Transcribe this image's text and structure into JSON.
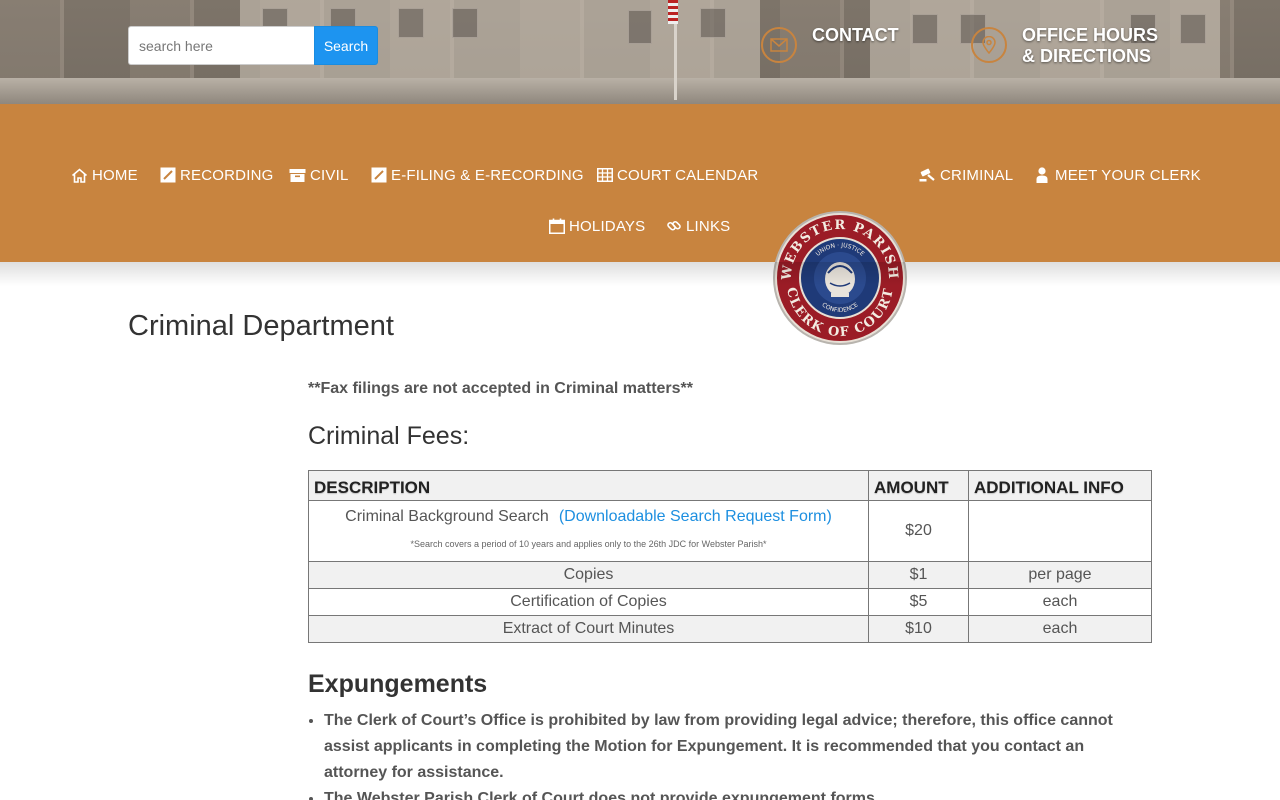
{
  "header": {
    "search_placeholder": "search here",
    "search_button": "Search",
    "contact_label": "CONTACT",
    "hours_label": "OFFICE HOURS\n& DIRECTIONS"
  },
  "nav": {
    "home": "HOME",
    "recording": "RECORDING",
    "civil": "CIVIL",
    "efiling": "E-FILING & E-RECORDING",
    "calendar": "COURT CALENDAR",
    "criminal": "CRIMINAL",
    "clerk": "MEET YOUR CLERK",
    "holidays": "HOLIDAYS",
    "links": "LINKS"
  },
  "seal": {
    "top_text": "WEBSTER PARISH",
    "bottom_text": "CLERK OF COURT",
    "inner_top": "UNION · JUSTICE",
    "inner_bottom": "CONFIDENCE"
  },
  "page": {
    "title": "Criminal Department",
    "fax_notice": "**Fax filings are not accepted in Criminal matters**",
    "fees_heading": "Criminal Fees:"
  },
  "fees_table": {
    "headers": [
      "DESCRIPTION",
      "AMOUNT",
      "ADDITIONAL INFO"
    ],
    "background_search": {
      "description": "Criminal Background Search",
      "link": "(Downloadable Search Request Form)",
      "note": "*Search covers a period of 10 years and applies only to the 26th JDC for Webster Parish*",
      "amount": "$20",
      "info": ""
    },
    "rows": [
      {
        "description": "Copies",
        "amount": "$1",
        "info": "per page"
      },
      {
        "description": "Certification of Copies",
        "amount": "$5",
        "info": "each"
      },
      {
        "description": "Extract of Court Minutes",
        "amount": "$10",
        "info": "each"
      }
    ]
  },
  "expungements": {
    "heading": "Expungements",
    "items": [
      "The Clerk of Court’s Office is prohibited by law from providing legal advice; therefore, this office cannot assist applicants in completing the Motion for Expungement. It is recommended that you contact an attorney for assistance.",
      "The Webster Parish Clerk of Court does not provide expungement forms."
    ]
  },
  "colors": {
    "nav_background": "#c8843f",
    "search_button": "#1d94f0",
    "link": "#1d8fe0",
    "seal_ring": "#9b1c26",
    "seal_center": "#1f3a78"
  },
  "icons": {
    "contact": "envelope-icon",
    "hours": "map-pin-icon",
    "home": "home-icon",
    "recording": "pencil-icon",
    "civil": "archive-box-icon",
    "efiling": "pencil-icon",
    "calendar": "table-grid-icon",
    "criminal": "gavel-icon",
    "clerk": "person-icon",
    "holidays": "calendar-icon",
    "links": "link-icon"
  }
}
